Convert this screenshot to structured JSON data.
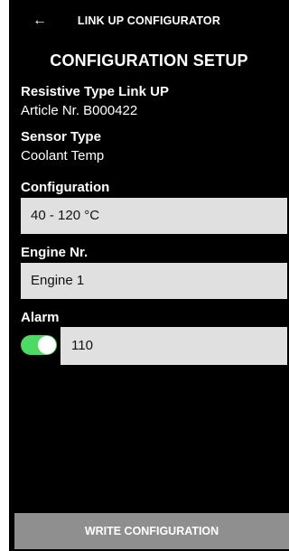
{
  "header": {
    "back_icon": "arrow-left-icon",
    "back_glyph": "←",
    "app_title": "LINK UP CONFIGURATOR"
  },
  "page": {
    "title": "CONFIGURATION SETUP"
  },
  "device": {
    "type_label": "Resistive Type Link UP",
    "article": "Article Nr. B000422"
  },
  "sensor": {
    "label": "Sensor Type",
    "value": "Coolant Temp"
  },
  "configuration": {
    "label": "Configuration",
    "value": "40 - 120 °C"
  },
  "engine": {
    "label": "Engine Nr.",
    "value": "Engine 1"
  },
  "alarm": {
    "label": "Alarm",
    "enabled": true,
    "value": "110"
  },
  "actions": {
    "write_label": "WRITE CONFIGURATION"
  },
  "colors": {
    "background": "#000000",
    "field": "#e0e0e0",
    "toggle_on": "#4cd964",
    "button": "#8f8f8f"
  }
}
